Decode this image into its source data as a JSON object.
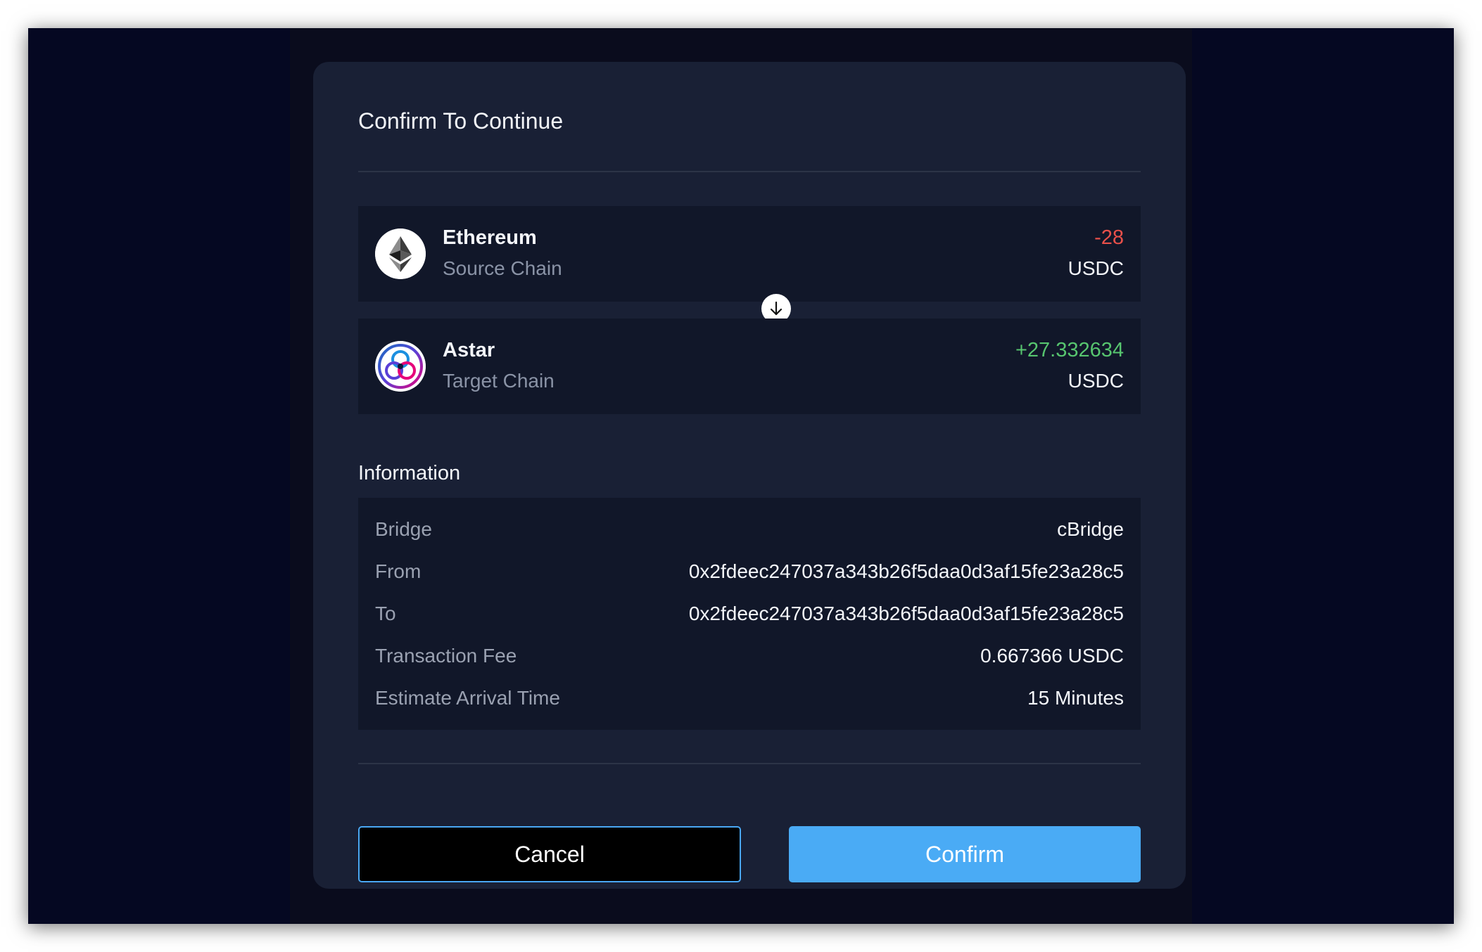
{
  "modal": {
    "title": "Confirm To Continue",
    "source": {
      "icon": "ethereum-icon",
      "name": "Ethereum",
      "role": "Source Chain",
      "amount": "-28",
      "token": "USDC"
    },
    "target": {
      "icon": "astar-icon",
      "name": "Astar",
      "role": "Target Chain",
      "amount": "+27.332634",
      "token": "USDC"
    },
    "swap_icon": "arrow-down-icon",
    "information": {
      "heading": "Information",
      "rows": [
        {
          "label": "Bridge",
          "value": "cBridge"
        },
        {
          "label": "From",
          "value": "0x2fdeec247037a343b26f5daa0d3af15fe23a28c5"
        },
        {
          "label": "To",
          "value": "0x2fdeec247037a343b26f5daa0d3af15fe23a28c5"
        },
        {
          "label": "Transaction Fee",
          "value": "0.667366 USDC"
        },
        {
          "label": "Estimate Arrival Time",
          "value": "15 Minutes"
        }
      ]
    },
    "buttons": {
      "cancel": "Cancel",
      "confirm": "Confirm"
    }
  },
  "colors": {
    "background": "#050822",
    "modal": "#192035",
    "card": "#111729",
    "negative": "#e8504a",
    "positive": "#57c56f",
    "accent": "#4aabf5"
  }
}
